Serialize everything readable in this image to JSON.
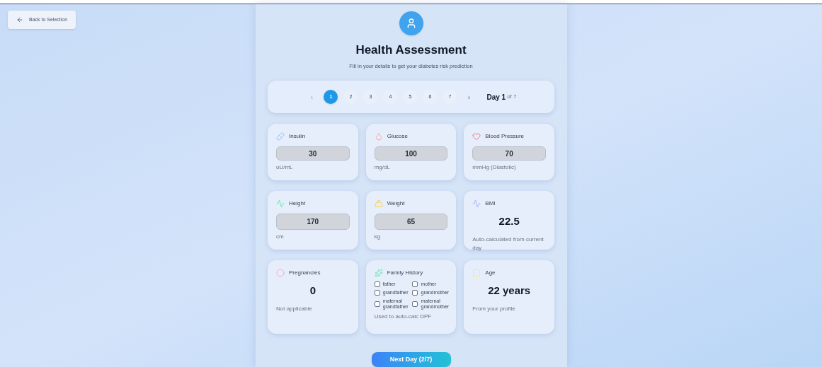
{
  "back_button": {
    "label": "Back to Selection"
  },
  "header": {
    "title": "Health Assessment",
    "subtitle": "Fill in your details to get your diabetes risk prediction"
  },
  "pagination": {
    "prev": "‹",
    "next": "›",
    "pages": [
      {
        "label": "1",
        "selected": true
      },
      {
        "label": "2",
        "selected": false
      },
      {
        "label": "3",
        "selected": false
      },
      {
        "label": "4",
        "selected": false
      },
      {
        "label": "5",
        "selected": false
      },
      {
        "label": "6",
        "selected": false
      },
      {
        "label": "7",
        "selected": false
      }
    ],
    "day_label": "Day 1",
    "day_total": "of 7"
  },
  "cards": [
    {
      "kind": "input",
      "label": "Insulin",
      "value": "30",
      "note": "uU/mL"
    },
    {
      "kind": "input",
      "label": "Glucose",
      "value": "100",
      "note": "mg/dL"
    },
    {
      "kind": "input",
      "label": "Blood Pressure",
      "value": "70",
      "note": "mmHg (Diastolic)"
    },
    {
      "kind": "input",
      "label": "Height",
      "value": "170",
      "note": "cm"
    },
    {
      "kind": "input",
      "label": "Weight",
      "value": "65",
      "note": "kg"
    },
    {
      "kind": "display",
      "label": "BMI",
      "value": "22.5",
      "note": "Auto-calculated from current day"
    },
    {
      "kind": "display",
      "label": "Pregnancies",
      "value": "0",
      "note": "Not applicable"
    },
    {
      "kind": "checkboxes",
      "label": "Family History",
      "options": [
        {
          "label": "father",
          "checked": false
        },
        {
          "label": "mother",
          "checked": false
        },
        {
          "label": "grandfather",
          "checked": false
        },
        {
          "label": "grandmother",
          "checked": false
        },
        {
          "label": "maternal grandfather",
          "checked": false
        },
        {
          "label": "maternal grandmother",
          "checked": false
        }
      ],
      "note": "Used to auto-calc DPF"
    },
    {
      "kind": "display",
      "label": "Age",
      "value": "22 years",
      "note": "From your profile"
    }
  ],
  "next_button": {
    "label": "Next Day (2/7)"
  }
}
